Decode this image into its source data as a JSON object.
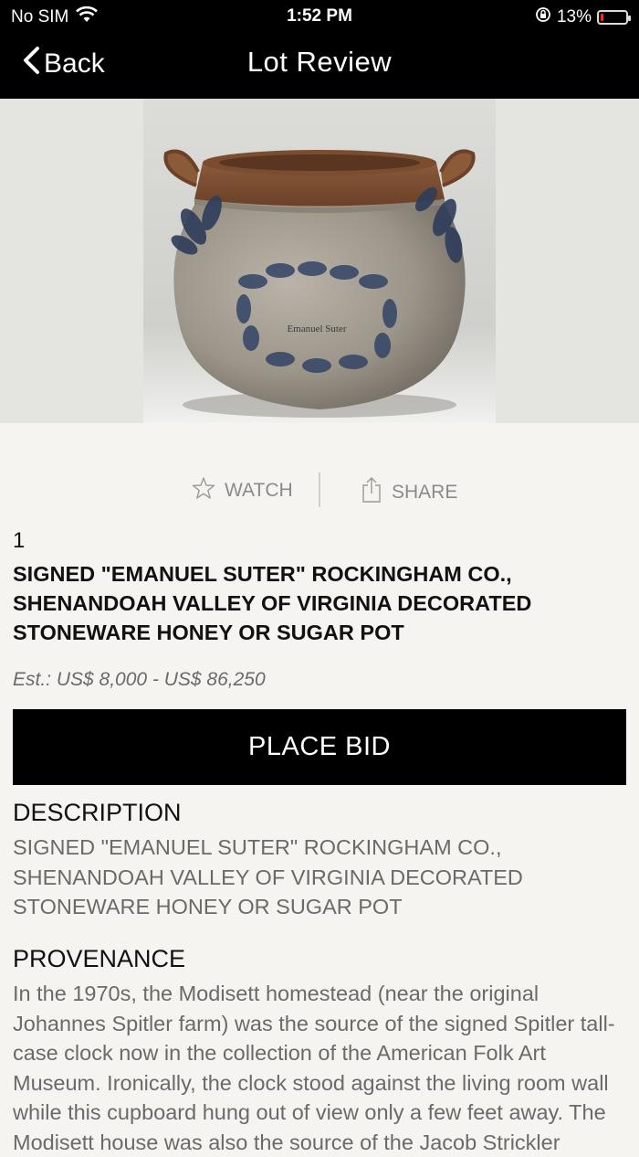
{
  "status": {
    "carrier": "No SIM",
    "time": "1:52 PM",
    "battery": "13%",
    "battery_level": 0.13
  },
  "nav": {
    "back_label": "Back",
    "title": "Lot Review"
  },
  "hero": {
    "image_text": "Emanuel Suter"
  },
  "actions": {
    "watch_label": "WATCH",
    "share_label": "SHARE"
  },
  "lot": {
    "number": "1",
    "title": "SIGNED \"EMANUEL SUTER\" ROCKINGHAM CO., SHENANDOAH VALLEY OF VIRGINIA DECORATED STONEWARE HONEY OR SUGAR POT",
    "estimate": "Est.: US$ 8,000 - US$ 86,250",
    "bid_label": "PLACE BID"
  },
  "description": {
    "heading": "DESCRIPTION",
    "body": "SIGNED \"EMANUEL SUTER\" ROCKINGHAM CO., SHENANDOAH VALLEY OF VIRGINIA DECORATED STONEWARE HONEY OR SUGAR POT"
  },
  "provenance": {
    "heading": "PROVENANCE",
    "body": "In the 1970s, the Modisett homestead (near the original Johannes Spitler farm) was the source of the signed Spitler tall-case clock now in the collection of the American Folk Art Museum. Ironically, the clock stood against the living room wall while this cupboard hung out of view only a few feet away. The Modisett house was also the source of the Jacob Strickler"
  }
}
